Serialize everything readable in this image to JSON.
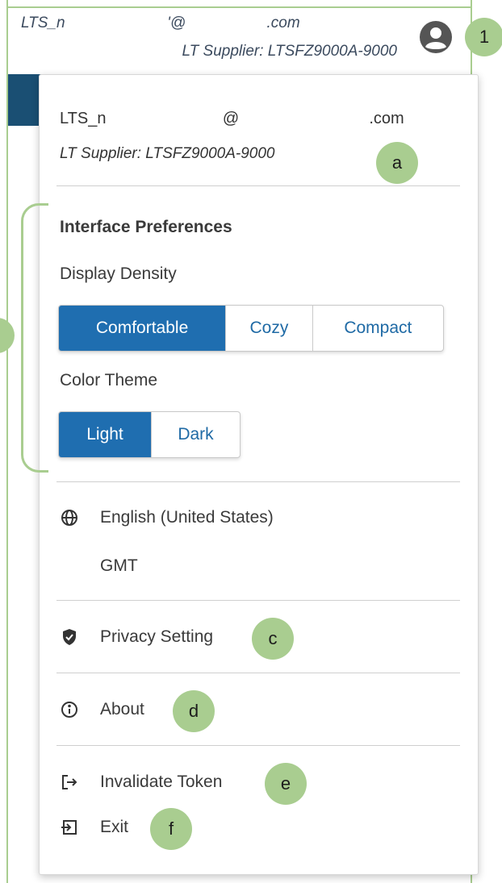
{
  "header": {
    "email": "LTS_n                        '@                   .com",
    "supplier": "LT Supplier: LTSFZ9000A-9000",
    "avatar_icon": "user-circle-icon"
  },
  "panel": {
    "email": "LTS_n                          @                             .com",
    "supplier": "LT Supplier: LTSFZ9000A-9000",
    "interface_preferences": {
      "title": "Interface Preferences",
      "display_density_label": "Display Density",
      "density_options": [
        "Comfortable",
        "Cozy",
        "Compact"
      ],
      "density_selected": "Comfortable",
      "color_theme_label": "Color Theme",
      "theme_options": [
        "Light",
        "Dark"
      ],
      "theme_selected": "Light"
    },
    "locale": {
      "language": "English (United States)",
      "language_icon": "globe-icon",
      "timezone": "GMT"
    },
    "privacy": {
      "label": "Privacy Setting",
      "icon": "shield-check-icon"
    },
    "about": {
      "label": "About",
      "icon": "info-icon"
    },
    "invalidate": {
      "label": "Invalidate Token",
      "icon": "logout-icon"
    },
    "exit": {
      "label": "Exit",
      "icon": "exit-icon"
    }
  },
  "annotations": {
    "one": "1",
    "a": "a",
    "c": "c",
    "d": "d",
    "e": "e",
    "f": "f"
  },
  "colors": {
    "accent": "#1f6eb0",
    "annotation": "#a9cd90",
    "header_dark": "#1a4f73"
  }
}
